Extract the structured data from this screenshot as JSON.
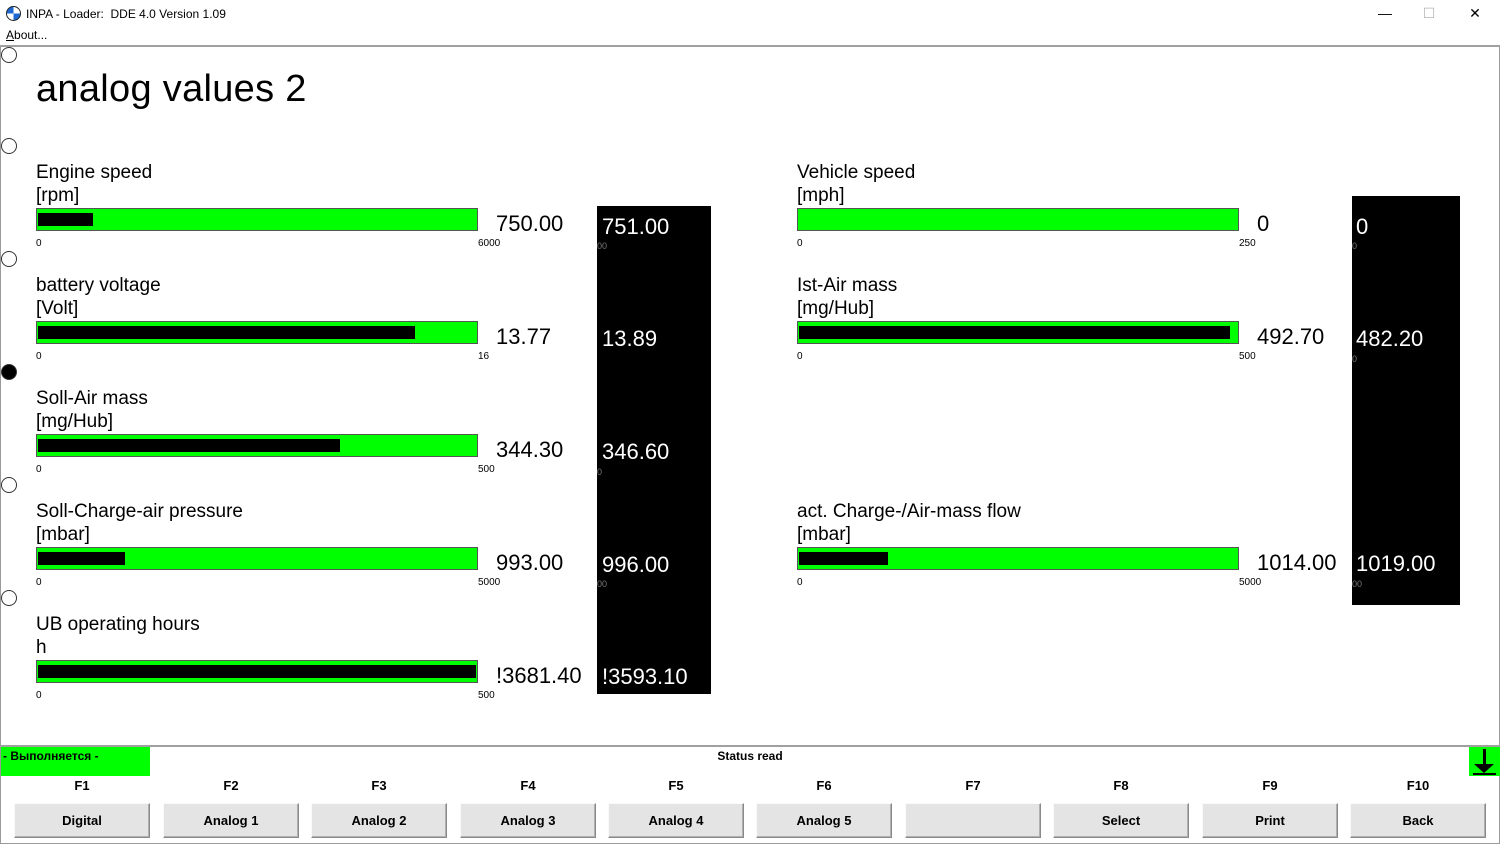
{
  "window": {
    "title": "INPA - Loader:  DDE 4.0 Version 1.09",
    "icon": "bmw-logo-icon",
    "controls": {
      "minimize": "—",
      "maximize": "☐",
      "close": "✕"
    }
  },
  "menu": {
    "about_prefix": "A",
    "about_rest": "bout..."
  },
  "page": {
    "title": "analog values 2"
  },
  "gauges": {
    "engine_speed": {
      "label": "Engine speed",
      "unit": "[rpm]",
      "min": "0",
      "max": "6000",
      "value": "750.00",
      "level": 0.125,
      "readout": "751.00"
    },
    "battery": {
      "label": "battery voltage",
      "unit": "[Volt]",
      "min": "0",
      "max": "16",
      "value": "13.77",
      "level": 0.86,
      "readout": "13.89"
    },
    "soll_air": {
      "label": "Soll-Air mass",
      "unit": "[mg/Hub]",
      "min": "0",
      "max": "500",
      "value": "344.30",
      "level": 0.689,
      "readout": "346.60"
    },
    "soll_charge": {
      "label": "Soll-Charge-air pressure",
      "unit": "[mbar]",
      "min": "0",
      "max": "5000",
      "value": "993.00",
      "level": 0.199,
      "readout": "996.00"
    },
    "ub_hours": {
      "label": "UB operating hours",
      "unit": "h",
      "min": "0",
      "max": "500",
      "value": "!3681.40",
      "level": 1.0,
      "readout": "!3593.10"
    },
    "vehicle_speed": {
      "label": "Vehicle speed",
      "unit": "[mph]",
      "min": "0",
      "max": "250",
      "value": "0",
      "level": 0.0,
      "readout": "0"
    },
    "ist_air": {
      "label": "Ist-Air mass",
      "unit": "[mg/Hub]",
      "min": "0",
      "max": "500",
      "value": "492.70",
      "level": 0.985,
      "readout": "482.20"
    },
    "act_charge": {
      "label": "act. Charge-/Air-mass flow",
      "unit": "[mbar]",
      "min": "0",
      "max": "5000",
      "value": "1014.00",
      "level": 0.203,
      "readout": "1019.00"
    }
  },
  "status": {
    "busy": "- Выполняется -",
    "text": "Status read",
    "arrow_icon": "down-arrow-icon",
    "colors": {
      "busy_bg": "#00ff00",
      "bar_bg": "#00ff00",
      "bar_fill": "#000000",
      "readout_bg": "#000000"
    }
  },
  "fkeys": [
    {
      "key": "F1",
      "label": "Digital"
    },
    {
      "key": "F2",
      "label": "Analog 1"
    },
    {
      "key": "F3",
      "label": "Analog 2"
    },
    {
      "key": "F4",
      "label": "Analog 3"
    },
    {
      "key": "F5",
      "label": "Analog 4"
    },
    {
      "key": "F6",
      "label": "Analog 5"
    },
    {
      "key": "F7",
      "label": ""
    },
    {
      "key": "F8",
      "label": "Select"
    },
    {
      "key": "F9",
      "label": "Print"
    },
    {
      "key": "F10",
      "label": "Back"
    }
  ]
}
